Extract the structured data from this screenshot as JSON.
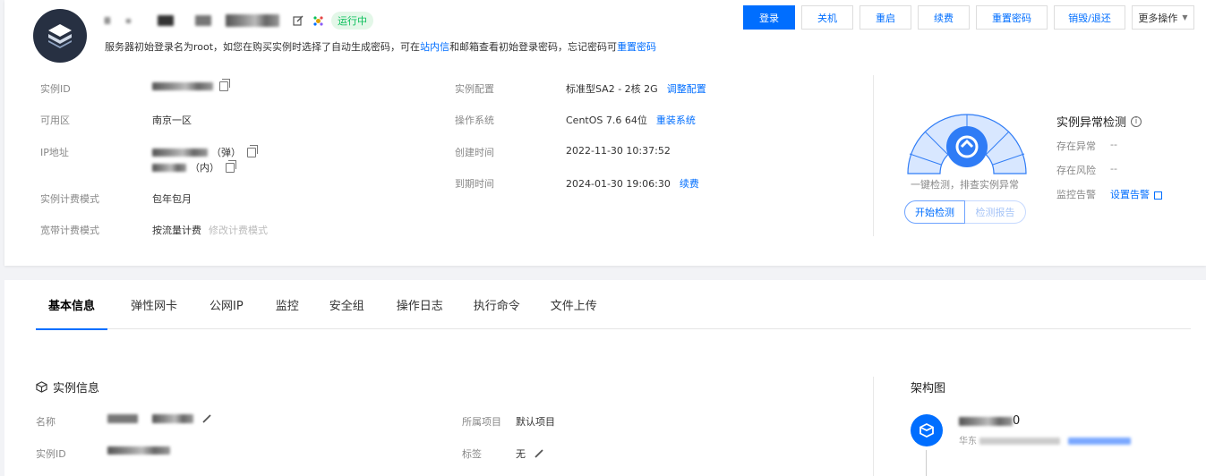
{
  "header": {
    "status": "运行中",
    "notice_prefix": "服务器初始登录名为root，如您在购买实例时选择了自动生成密码，可在",
    "notice_link1": "站内信",
    "notice_mid": "和邮箱查看初始登录密码，忘记密码可",
    "notice_link2": "重置密码"
  },
  "actions": {
    "login": "登录",
    "shutdown": "关机",
    "restart": "重启",
    "renew": "续费",
    "reset_password": "重置密码",
    "destroy": "销毁/退还",
    "more": "更多操作"
  },
  "instance": {
    "id_label": "实例ID",
    "zone_label": "可用区",
    "zone": "南京一区",
    "ip_label": "IP地址",
    "ip_public_suffix": "（弹）",
    "ip_private_suffix": "（内）",
    "billing_label": "实例计费模式",
    "billing": "包年包月",
    "bandwidth_label": "宽带计费模式",
    "bandwidth": "按流量计费",
    "bandwidth_action": "修改计费模式",
    "config_label": "实例配置",
    "config": "标准型SA2 - 2核 2G",
    "config_action": "调整配置",
    "os_label": "操作系统",
    "os": "CentOS 7.6 64位",
    "os_action": "重装系统",
    "created_label": "创建时间",
    "created": "2022-11-30 10:37:52",
    "expire_label": "到期时间",
    "expire": "2024-01-30 19:06:30",
    "expire_action": "续费"
  },
  "check": {
    "caption": "一键检测，排查实例异常",
    "start": "开始检测",
    "report": "检测报告",
    "title": "实例异常检测",
    "exists_label": "存在异常",
    "exists_value": "--",
    "risk_label": "存在风险",
    "risk_value": "--",
    "alarm_label": "监控告警",
    "alarm_action": "设置告警"
  },
  "tabs": [
    {
      "label": "基本信息"
    },
    {
      "label": "弹性网卡"
    },
    {
      "label": "公网IP"
    },
    {
      "label": "监控"
    },
    {
      "label": "安全组"
    },
    {
      "label": "操作日志"
    },
    {
      "label": "执行命令"
    },
    {
      "label": "文件上传"
    }
  ],
  "detail": {
    "section_title": "实例信息",
    "name_label": "名称",
    "id_label": "实例ID",
    "project_label": "所属项目",
    "project": "默认项目",
    "tag_label": "标签",
    "tag": "无",
    "arch_title": "架构图",
    "arch_name_suffix": "0",
    "arch_sub_prefix": "华东"
  },
  "colors": {
    "primary": "#006eff",
    "running": "#0abf5b"
  }
}
